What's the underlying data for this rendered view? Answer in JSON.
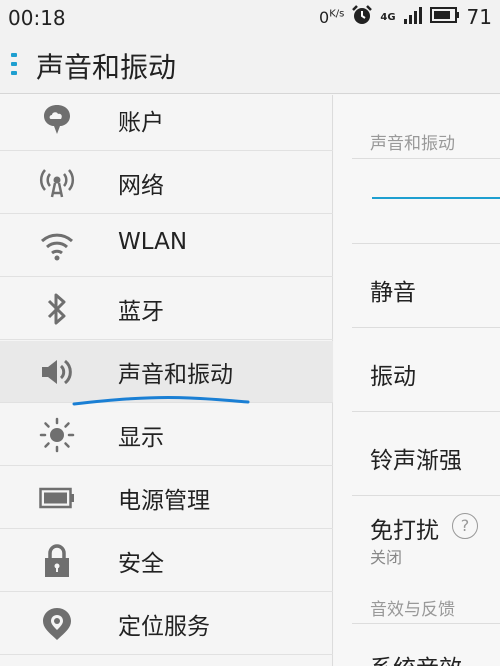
{
  "status_bar": {
    "time": "00:18",
    "net_speed": "0",
    "net_speed_unit": "K/s",
    "network_type": "4G",
    "battery_level": "71"
  },
  "header": {
    "title": "声音和振动"
  },
  "sidebar": {
    "items": [
      {
        "label": "账户",
        "icon": "cloud-account-icon"
      },
      {
        "label": "网络",
        "icon": "antenna-icon"
      },
      {
        "label": "WLAN",
        "icon": "wifi-icon"
      },
      {
        "label": "蓝牙",
        "icon": "bluetooth-icon"
      },
      {
        "label": "声音和振动",
        "icon": "speaker-icon",
        "selected": true
      },
      {
        "label": "显示",
        "icon": "brightness-icon"
      },
      {
        "label": "电源管理",
        "icon": "battery-icon"
      },
      {
        "label": "安全",
        "icon": "lock-icon"
      },
      {
        "label": "定位服务",
        "icon": "location-pin-icon"
      }
    ]
  },
  "detail": {
    "section_sound": "声音和振动",
    "items": [
      {
        "label": "静音"
      },
      {
        "label": "振动"
      },
      {
        "label": "铃声渐强"
      },
      {
        "label": "免打扰",
        "sub": "关闭"
      }
    ],
    "section_effects": "音效与反馈",
    "partial_item": "系统音效"
  },
  "colors": {
    "accent": "#1e9fd0",
    "annotation_stroke": "#1a7fd4",
    "icon_gray": "#6f6f6f"
  }
}
